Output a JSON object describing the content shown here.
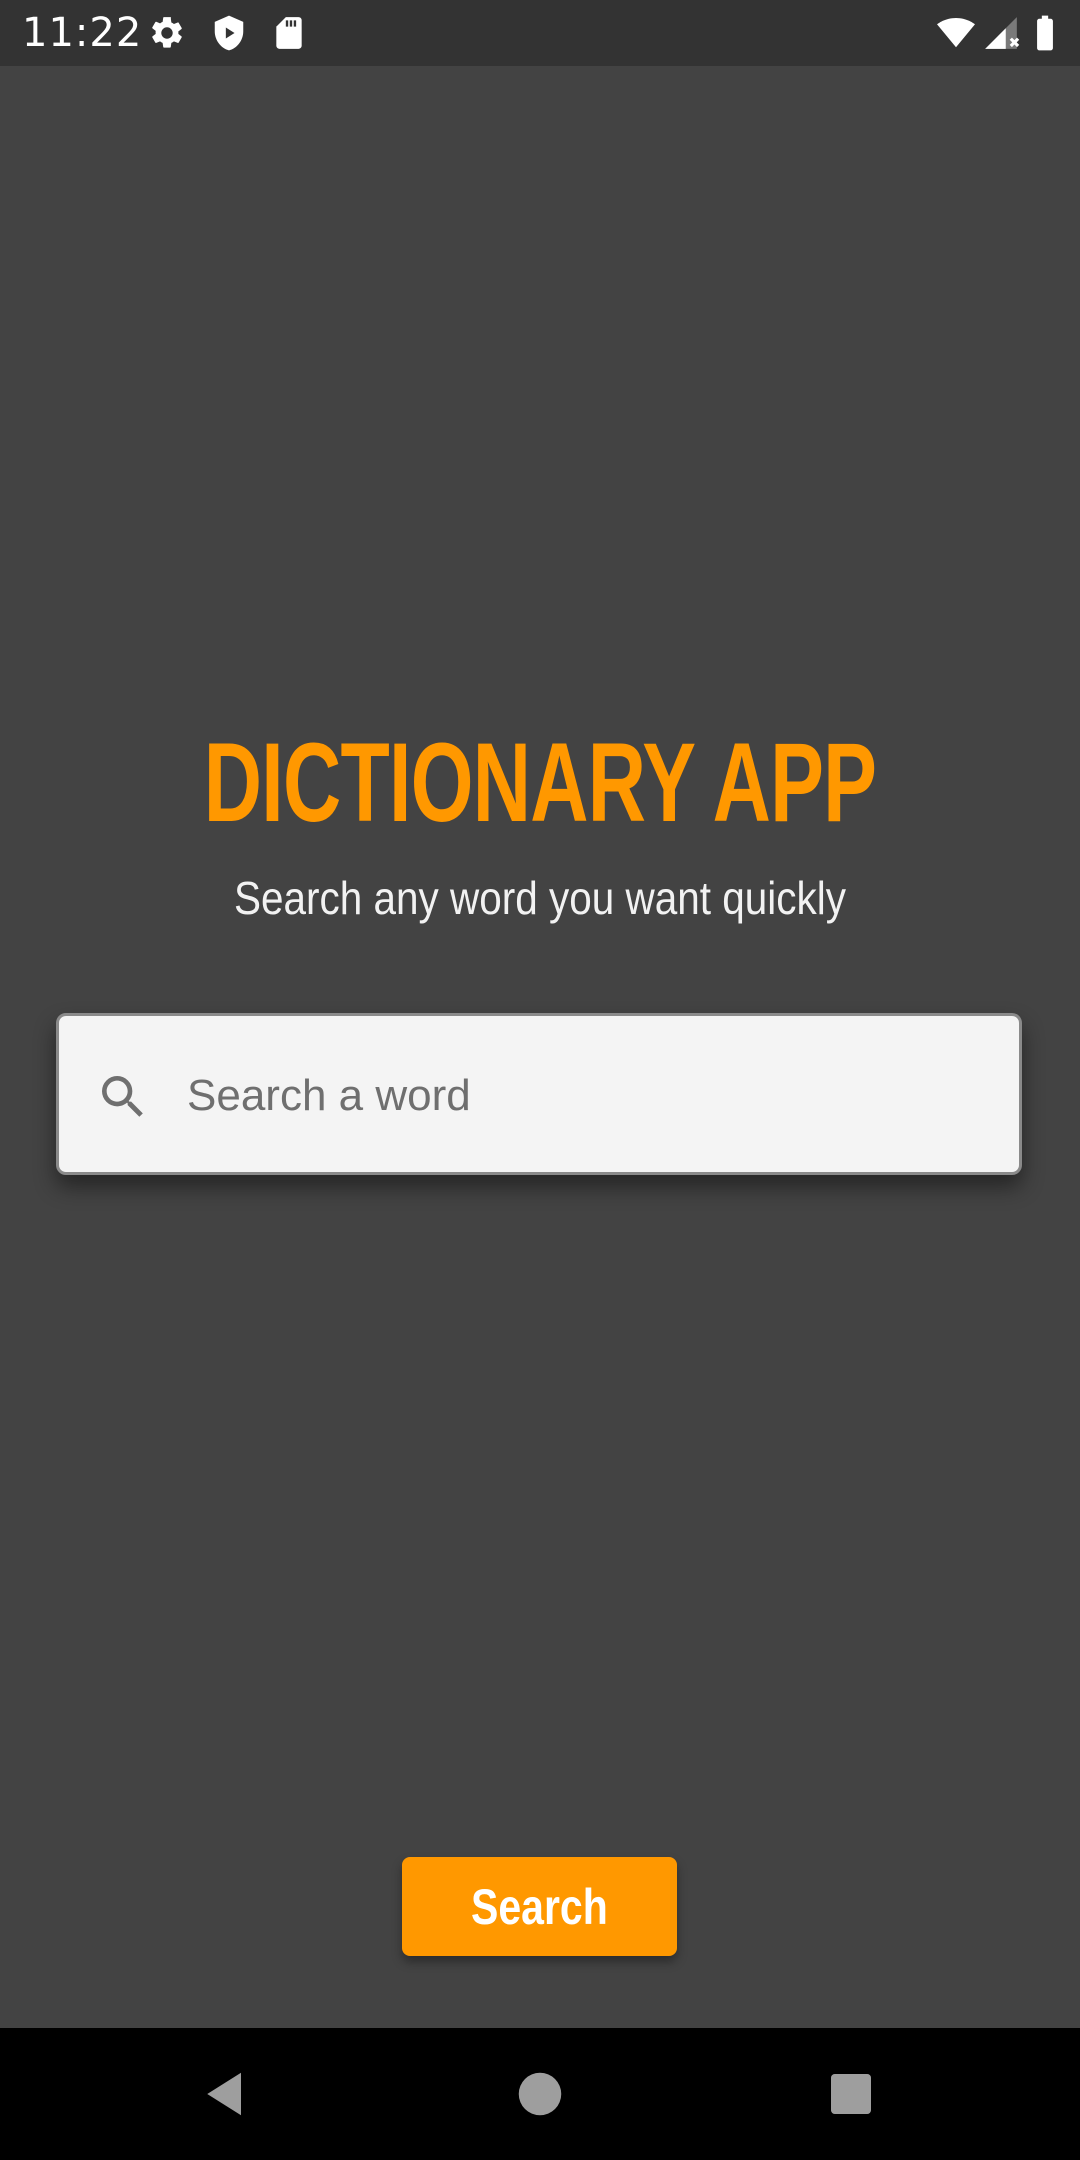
{
  "status_bar": {
    "time": "11:22",
    "left_icons": [
      "gear-icon",
      "shield-icon",
      "sd-card-icon"
    ],
    "right_icons": [
      "wifi-icon",
      "cell-signal-icon",
      "battery-icon"
    ]
  },
  "main": {
    "title": "DICTIONARY APP",
    "subtitle": "Search any word you want quickly",
    "search": {
      "placeholder": "Search a word",
      "value": ""
    },
    "search_button_label": "Search"
  },
  "nav_bar": {
    "buttons": [
      "back-icon",
      "home-icon",
      "recents-icon"
    ]
  },
  "colors": {
    "accent": "#FF9800",
    "background": "#434343",
    "status_bar": "#333333",
    "nav_bar": "#000000",
    "search_box": "#F4F4F4"
  }
}
